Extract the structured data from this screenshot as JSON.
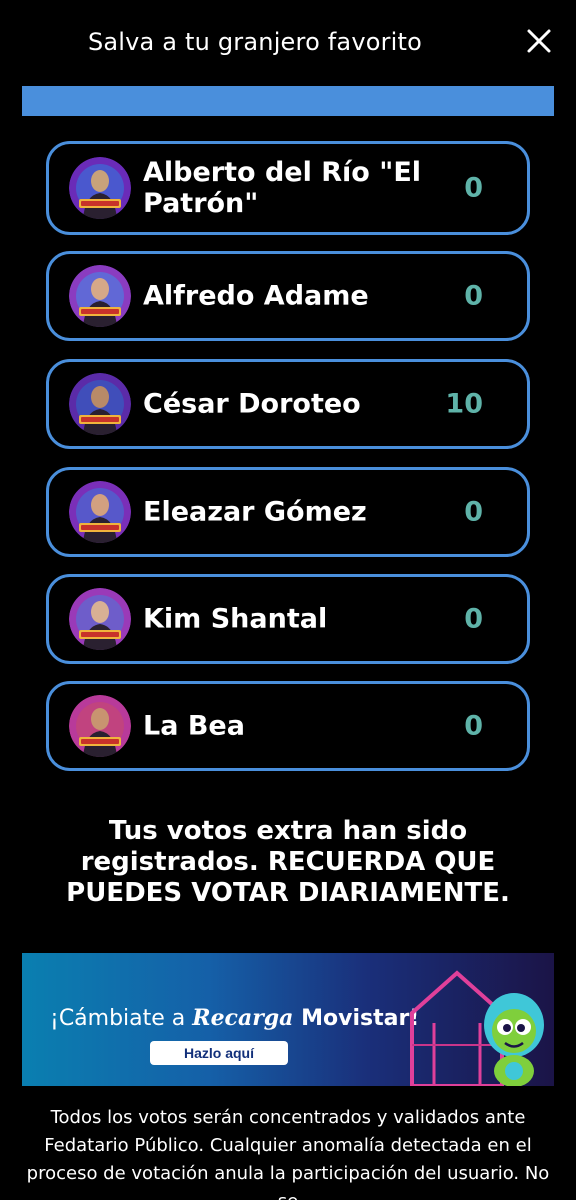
{
  "header": {
    "title": "Salva a tu granjero favorito",
    "close_icon": "close-icon"
  },
  "colors": {
    "accent_blue": "#4a8fdc",
    "count_teal": "#5fb3a9",
    "background": "#000000"
  },
  "candidates": [
    {
      "name": "Alberto del Río \"El Patrón\"",
      "votes": "0"
    },
    {
      "name": "Alfredo Adame",
      "votes": "0"
    },
    {
      "name": "César Doroteo",
      "votes": "10"
    },
    {
      "name": "Eleazar Gómez",
      "votes": "0"
    },
    {
      "name": "Kim Shantal",
      "votes": "0"
    },
    {
      "name": "La Bea",
      "votes": "0"
    }
  ],
  "message": "Tus votos extra han sido registrados. RECUERDA QUE PUEDES VOTAR DIARIAMENTE.",
  "banner": {
    "text_prefix": "¡Cámbiate a ",
    "brand": "Recarga",
    "text_suffix": " Movistar!",
    "button_label": "Hazlo aquí"
  },
  "disclaimer": "Todos los votos serán concentrados y validados ante Fedatario Público. Cualquier anomalía detectada en el proceso de votación anula la participación del usuario. No se"
}
